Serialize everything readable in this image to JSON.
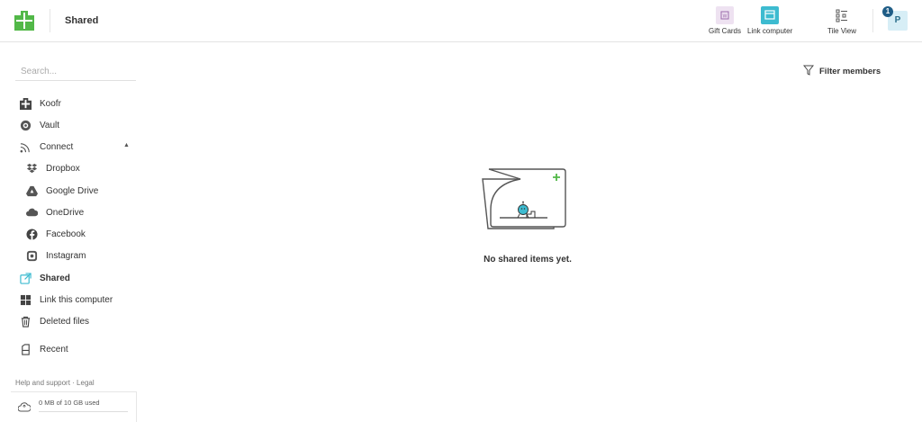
{
  "header": {
    "title": "Shared",
    "gift_label": "Gift Cards",
    "link_label": "Link computer",
    "tile_label": "Tile View",
    "avatar_initial": "P",
    "notification_count": "1",
    "accent_color": "#3dbbd0",
    "logo_color": "#52b848"
  },
  "sidebar": {
    "search_placeholder": "Search...",
    "items": [
      {
        "label": "Koofr",
        "icon": "home-icon"
      },
      {
        "label": "Vault",
        "icon": "vault-icon"
      },
      {
        "label": "Connect",
        "icon": "rss-icon"
      },
      {
        "label": "Dropbox",
        "icon": "dropbox-icon"
      },
      {
        "label": "Google Drive",
        "icon": "google-drive-icon"
      },
      {
        "label": "OneDrive",
        "icon": "cloud-icon"
      },
      {
        "label": "Facebook",
        "icon": "facebook-icon"
      },
      {
        "label": "Instagram",
        "icon": "instagram-icon"
      },
      {
        "label": "Shared",
        "icon": "share-icon"
      },
      {
        "label": "Link this computer",
        "icon": "windows-icon"
      },
      {
        "label": "Deleted files",
        "icon": "trash-icon"
      },
      {
        "label": "Recent",
        "icon": "recent-icon"
      }
    ],
    "help_text": "Help and support · Legal",
    "storage_text": "0 MB of 10 GB used",
    "storage_used_fraction": 0
  },
  "main": {
    "filter_label": "Filter members",
    "empty_message": "No shared items yet."
  }
}
